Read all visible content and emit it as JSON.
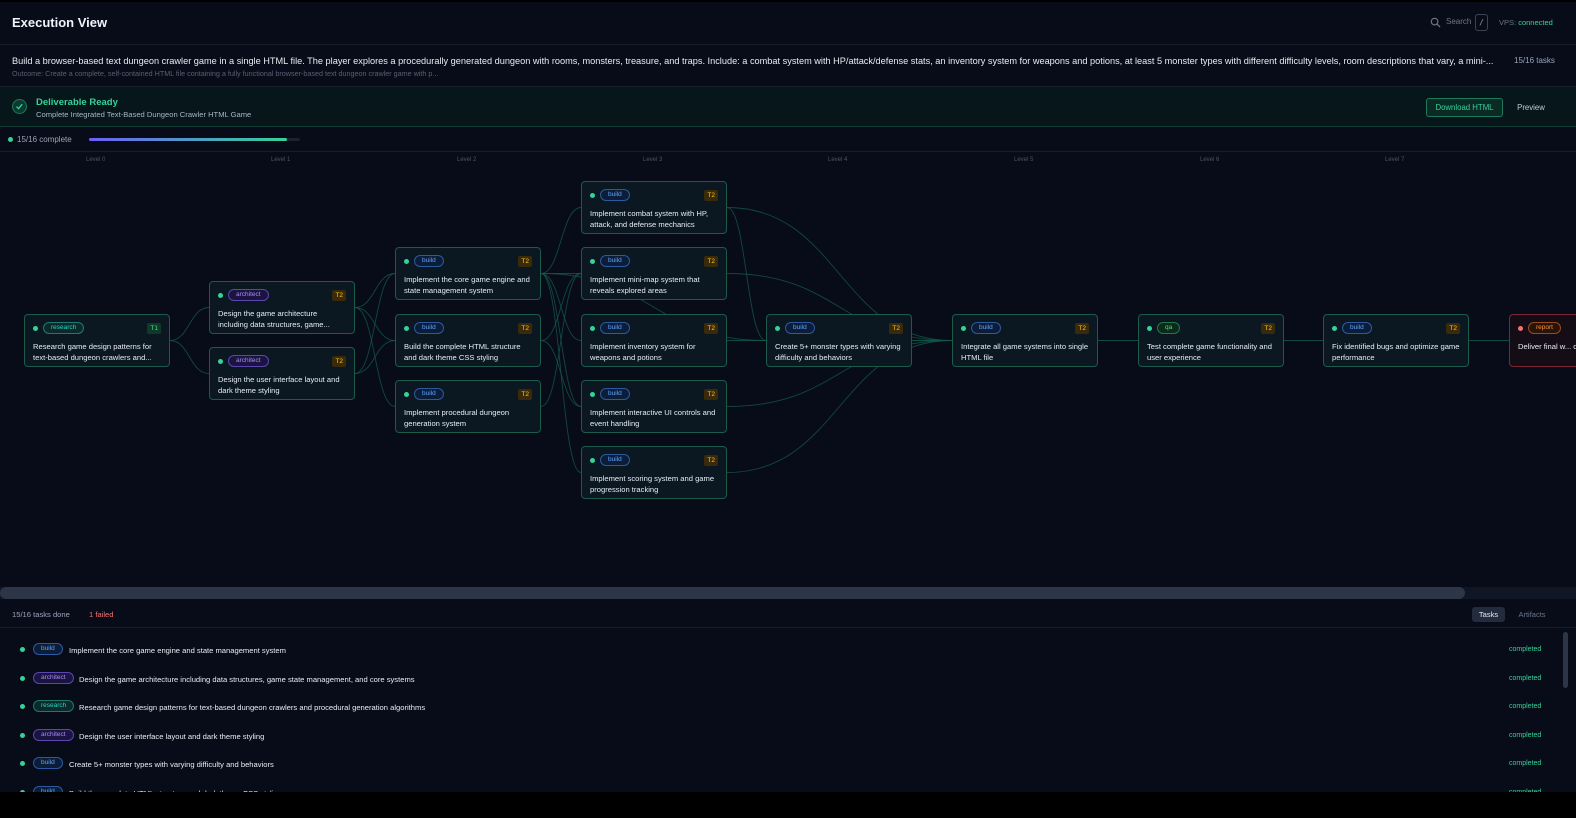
{
  "header": {
    "title": "Execution View",
    "search_label": "Search",
    "search_shortcut": "/",
    "vps_label": "VPS:",
    "vps_status": "connected"
  },
  "goal": {
    "text": "Build a browser-based text dungeon crawler game in a single HTML file. The player explores a procedurally generated dungeon with rooms, monsters, treasure, and traps. Include: a combat system with HP/attack/defense stats, an inventory system for weapons and potions, at least 5 monster types with different difficulty levels, room descriptions that vary, a mini-...",
    "outcome": "Outcome: Create a complete, self-contained HTML file containing a fully functional browser-based text dungeon crawler game with p...",
    "count": "15/16 tasks"
  },
  "deliverable": {
    "title": "Deliverable Ready",
    "subtitle": "Complete Integrated Text-Based Dungeon Crawler HTML Game",
    "download_label": "Download HTML",
    "preview_label": "Preview"
  },
  "progress": {
    "label": "15/16 complete",
    "fraction": 0.9375
  },
  "levels": [
    "Level 0",
    "Level 1",
    "Level 2",
    "Level 3",
    "Level 4",
    "Level 5",
    "Level 6",
    "Level 7"
  ],
  "nodes": [
    {
      "id": "n0",
      "tag": "research",
      "tier": "T1",
      "title": "Research game design patterns for text-based dungeon crawlers and...",
      "status": "completed"
    },
    {
      "id": "n1",
      "tag": "architect",
      "tier": "T2",
      "title": "Design the game architecture including data structures, game...",
      "status": "completed"
    },
    {
      "id": "n2",
      "tag": "architect",
      "tier": "T2",
      "title": "Design the user interface layout and dark theme styling",
      "status": "completed"
    },
    {
      "id": "n3",
      "tag": "build",
      "tier": "T2",
      "title": "Implement the core game engine and state management system",
      "status": "completed"
    },
    {
      "id": "n4",
      "tag": "build",
      "tier": "T2",
      "title": "Build the complete HTML structure and dark theme CSS styling",
      "status": "completed"
    },
    {
      "id": "n5",
      "tag": "build",
      "tier": "T2",
      "title": "Implement procedural dungeon generation system",
      "status": "completed"
    },
    {
      "id": "n6",
      "tag": "build",
      "tier": "T2",
      "title": "Implement combat system with HP, attack, and defense mechanics",
      "status": "completed"
    },
    {
      "id": "n7",
      "tag": "build",
      "tier": "T2",
      "title": "Implement mini-map system that reveals explored areas",
      "status": "completed"
    },
    {
      "id": "n8",
      "tag": "build",
      "tier": "T2",
      "title": "Implement inventory system for weapons and potions",
      "status": "completed"
    },
    {
      "id": "n9",
      "tag": "build",
      "tier": "T2",
      "title": "Implement interactive UI controls and event handling",
      "status": "completed"
    },
    {
      "id": "n10",
      "tag": "build",
      "tier": "T2",
      "title": "Implement scoring system and game progression tracking",
      "status": "completed"
    },
    {
      "id": "n11",
      "tag": "build",
      "tier": "T2",
      "title": "Create 5+ monster types with varying difficulty and behaviors",
      "status": "completed"
    },
    {
      "id": "n12",
      "tag": "build",
      "tier": "T2",
      "title": "Integrate all game systems into single HTML file",
      "status": "completed"
    },
    {
      "id": "n13",
      "tag": "qa",
      "tier": "T2",
      "title": "Test complete game functionality and user experience",
      "status": "completed"
    },
    {
      "id": "n14",
      "tag": "build",
      "tier": "T2",
      "title": "Fix identified bugs and optimize game performance",
      "status": "completed"
    },
    {
      "id": "n15",
      "tag": "report",
      "tier": "",
      "title": "Deliver final w... director appro...",
      "status": "failed"
    }
  ],
  "edges": [
    [
      "n0",
      "n1"
    ],
    [
      "n0",
      "n2"
    ],
    [
      "n1",
      "n3"
    ],
    [
      "n1",
      "n4"
    ],
    [
      "n1",
      "n5"
    ],
    [
      "n2",
      "n3"
    ],
    [
      "n2",
      "n4"
    ],
    [
      "n3",
      "n6"
    ],
    [
      "n3",
      "n7"
    ],
    [
      "n3",
      "n8"
    ],
    [
      "n3",
      "n9"
    ],
    [
      "n3",
      "n10"
    ],
    [
      "n4",
      "n9"
    ],
    [
      "n5",
      "n7"
    ],
    [
      "n4",
      "n7"
    ],
    [
      "n3",
      "n11"
    ],
    [
      "n6",
      "n12"
    ],
    [
      "n7",
      "n12"
    ],
    [
      "n8",
      "n12"
    ],
    [
      "n9",
      "n12"
    ],
    [
      "n10",
      "n12"
    ],
    [
      "n11",
      "n12"
    ],
    [
      "n6",
      "n11"
    ],
    [
      "n12",
      "n13"
    ],
    [
      "n13",
      "n14"
    ],
    [
      "n14",
      "n15"
    ]
  ],
  "bottom": {
    "done_label": "15/16 tasks done",
    "failed_label": "1 failed",
    "tab_tasks": "Tasks",
    "tab_artifacts": "Artifacts"
  },
  "tasks": [
    {
      "tag": "build",
      "title": "Implement the core game engine and state management system",
      "status": "completed"
    },
    {
      "tag": "architect",
      "title": "Design the game architecture including data structures, game state management, and core systems",
      "status": "completed"
    },
    {
      "tag": "research",
      "title": "Research game design patterns for text-based dungeon crawlers and procedural generation algorithms",
      "status": "completed"
    },
    {
      "tag": "architect",
      "title": "Design the user interface layout and dark theme styling",
      "status": "completed"
    },
    {
      "tag": "build",
      "title": "Create 5+ monster types with varying difficulty and behaviors",
      "status": "completed"
    },
    {
      "tag": "build",
      "title": "Build the complete HTML structure and dark theme CSS styling",
      "status": "completed"
    }
  ],
  "colors": {
    "accent_green": "#34d399",
    "failed_red": "#f87171",
    "background": "#080c18"
  }
}
